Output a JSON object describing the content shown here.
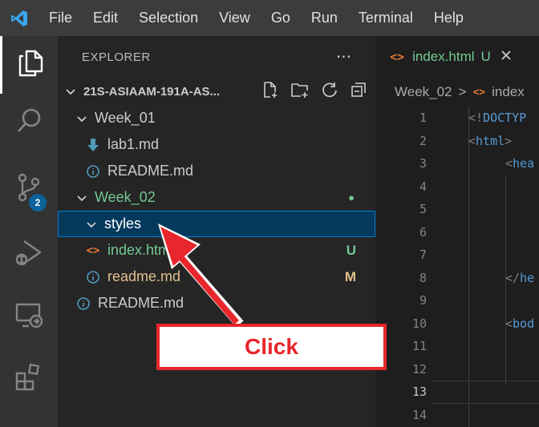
{
  "menu": [
    "File",
    "Edit",
    "Selection",
    "View",
    "Go",
    "Run",
    "Terminal",
    "Help"
  ],
  "activity": {
    "scm_badge": "2"
  },
  "explorer": {
    "title": "EXPLORER",
    "more": "···",
    "folder": "21S-ASIAAM-191A-AS...",
    "tree": [
      {
        "label": "Week_01",
        "type": "folder",
        "color": "#cccccc",
        "status": "",
        "status_color": ""
      },
      {
        "label": "lab1.md",
        "type": "file-down",
        "color": "#cccccc",
        "status": "",
        "status_color": ""
      },
      {
        "label": "README.md",
        "type": "file-info",
        "color": "#cccccc",
        "status": "",
        "status_color": ""
      },
      {
        "label": "Week_02",
        "type": "folder",
        "color": "#73c991",
        "status": "●",
        "status_color": "#73c991"
      },
      {
        "label": "styles",
        "type": "folder",
        "color": "#ffffff",
        "status": "",
        "status_color": "",
        "selected": true
      },
      {
        "label": "index.html",
        "type": "file-html",
        "color": "#73c991",
        "status": "U",
        "status_color": "#73c991"
      },
      {
        "label": "readme.md",
        "type": "file-info",
        "color": "#e2c08d",
        "status": "M",
        "status_color": "#e2c08d"
      },
      {
        "label": "README.md",
        "type": "file-info",
        "color": "#cccccc",
        "status": "",
        "status_color": ""
      }
    ]
  },
  "editor": {
    "tab_label": "index.html",
    "tab_status": "U",
    "breadcrumb_folder": "Week_02",
    "breadcrumb_sep": ">",
    "breadcrumb_file": "index",
    "line_numbers": [
      "1",
      "2",
      "3",
      "4",
      "5",
      "6",
      "7",
      "8",
      "9",
      "10",
      "11",
      "12",
      "13",
      "14"
    ],
    "active_line": "13",
    "code": [
      {
        "text": "<!DOCTYP",
        "indent": 0
      },
      {
        "text": "<html>",
        "indent": 0
      },
      {
        "text": "<hea",
        "indent": 1
      },
      {
        "text": "",
        "indent": 0
      },
      {
        "text": "",
        "indent": 0
      },
      {
        "text": "",
        "indent": 0
      },
      {
        "text": "",
        "indent": 0
      },
      {
        "text": "</he",
        "indent": 1
      },
      {
        "text": "",
        "indent": 0
      },
      {
        "text": "<bod",
        "indent": 1
      },
      {
        "text": "",
        "indent": 0
      },
      {
        "text": "",
        "indent": 0
      },
      {
        "text": "",
        "indent": 0
      },
      {
        "text": "",
        "indent": 0
      }
    ]
  },
  "annotation": {
    "callout": "Click"
  },
  "colors": {
    "accent": "#007fd4",
    "arrow": "#e8262b",
    "git_added": "#73c991",
    "git_modified": "#e2c08d"
  }
}
